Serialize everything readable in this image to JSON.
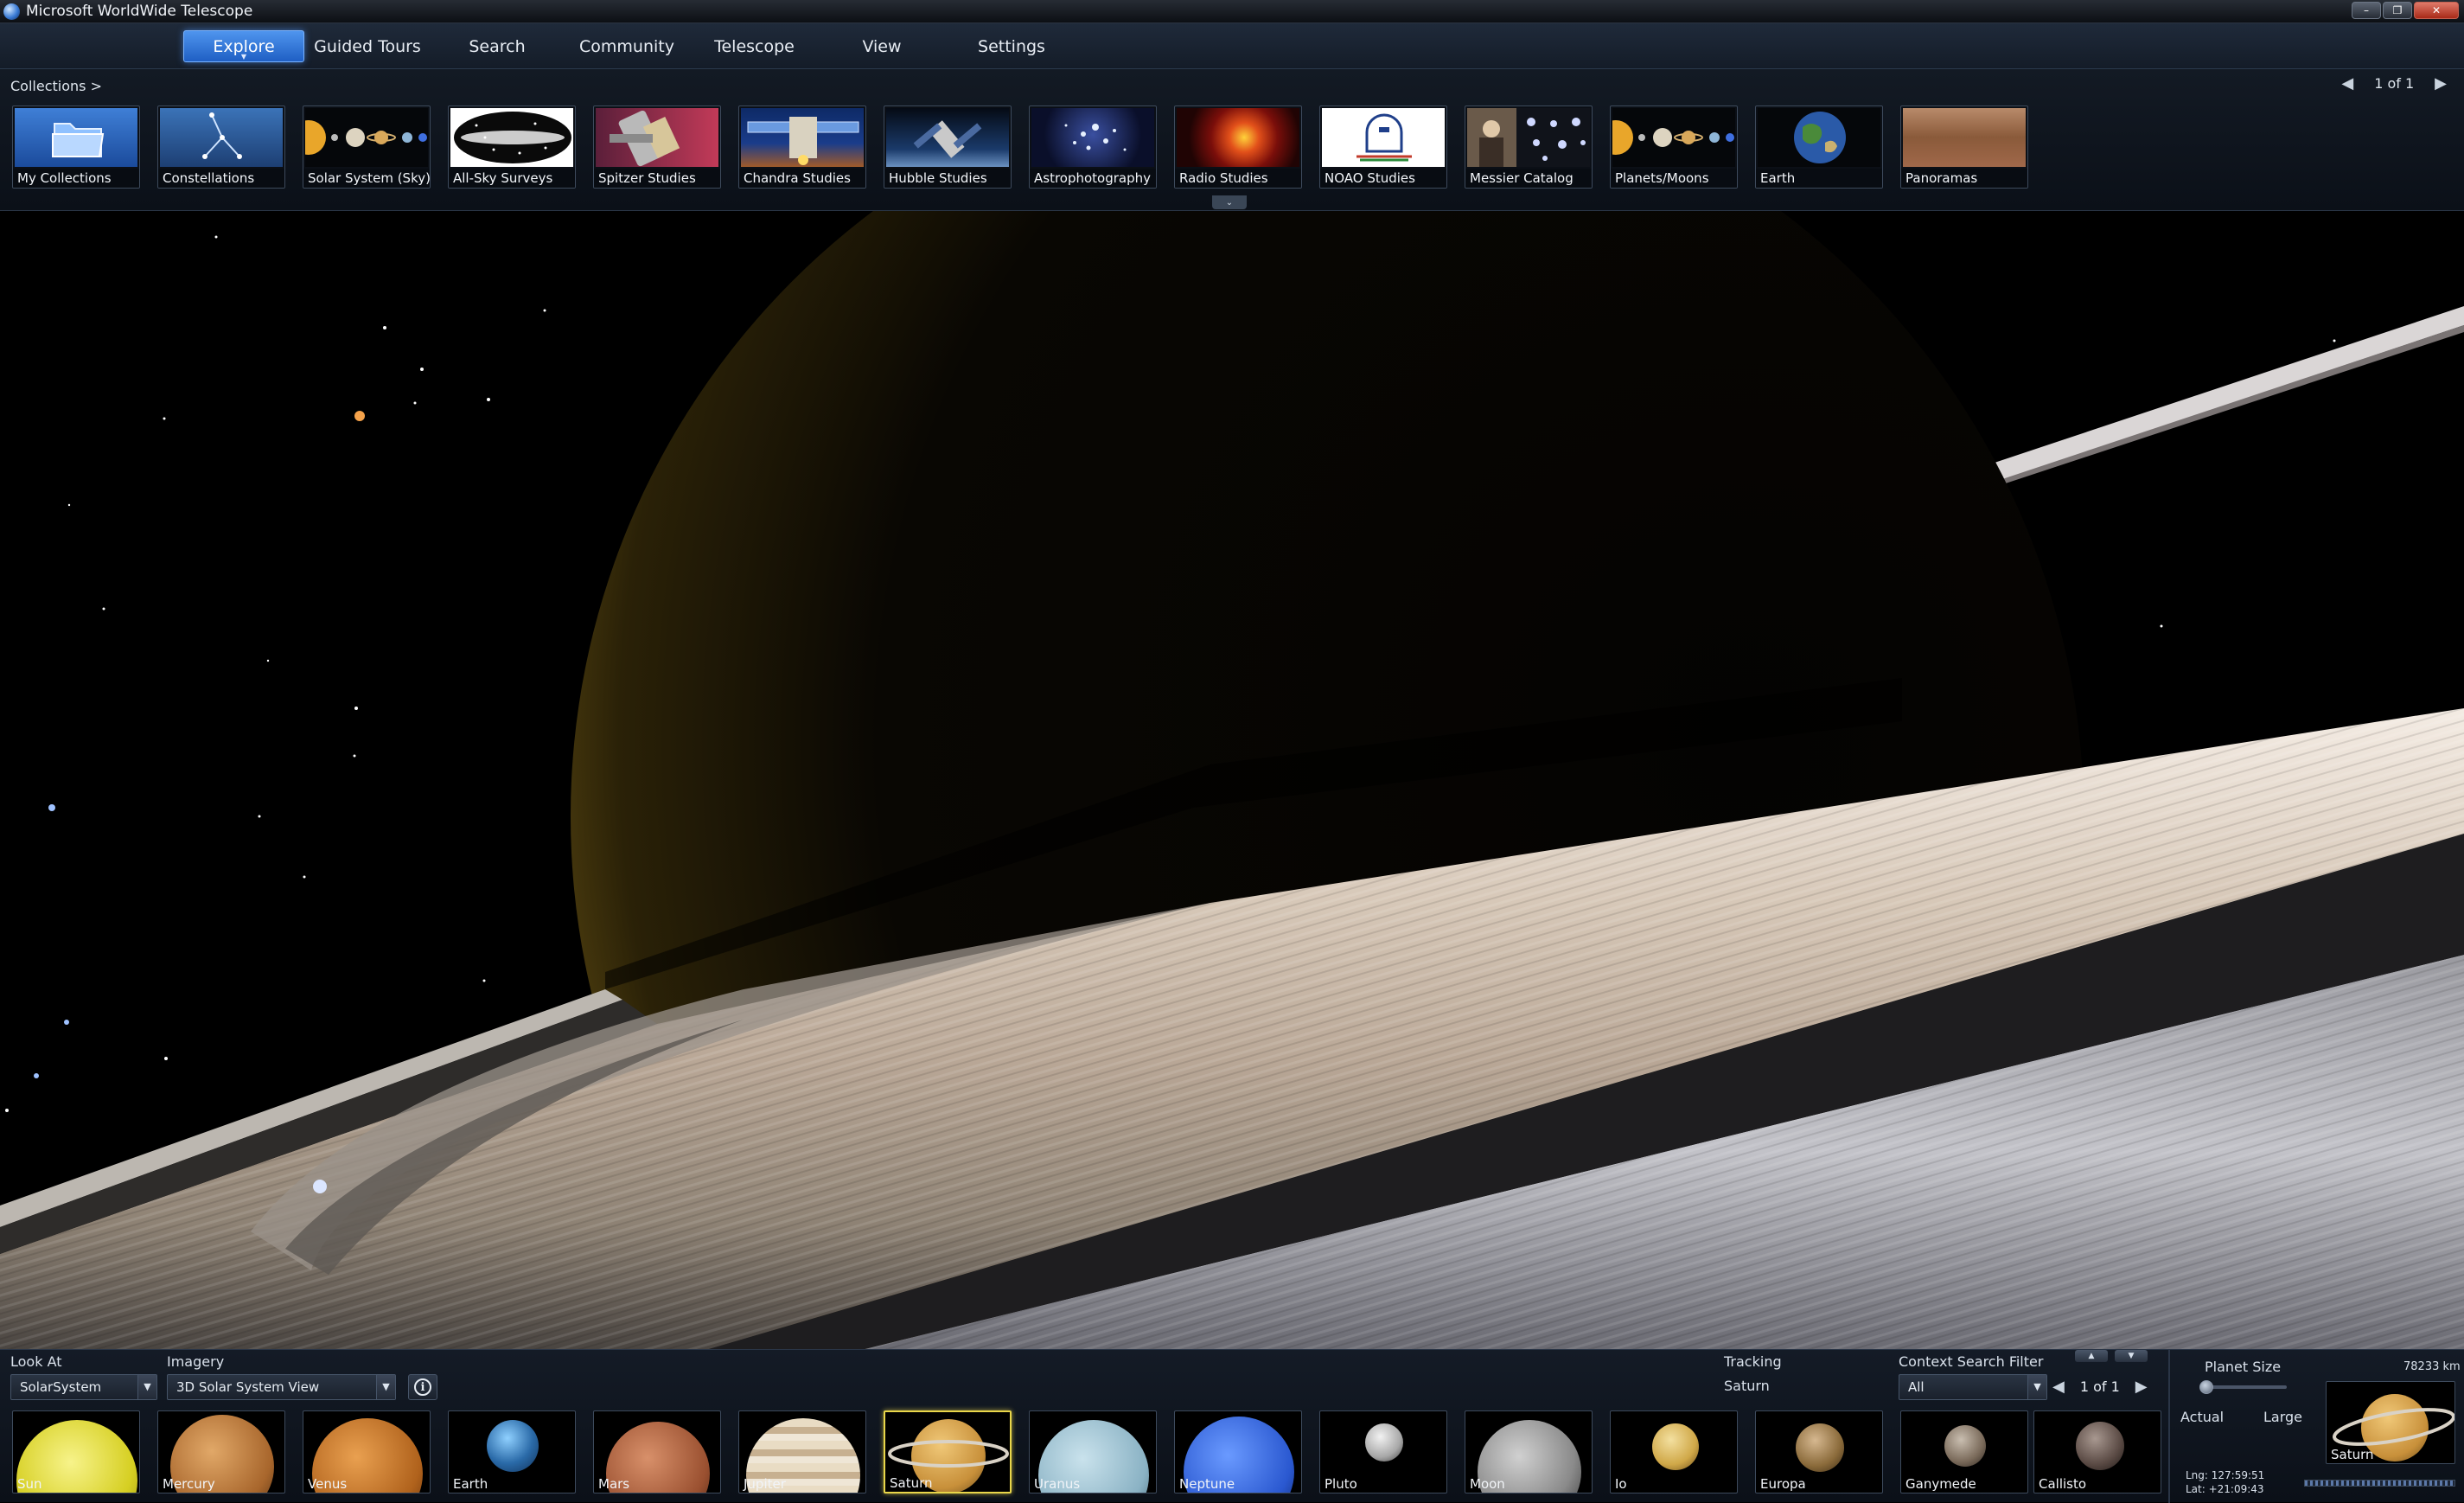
{
  "window": {
    "title": "Microsoft WorldWide Telescope",
    "controls": [
      "–",
      "❐",
      "✕"
    ]
  },
  "menu": {
    "items": [
      {
        "label": "Explore",
        "active": true
      },
      {
        "label": "Guided Tours",
        "active": false
      },
      {
        "label": "Search",
        "active": false
      },
      {
        "label": "Community",
        "active": false
      },
      {
        "label": "Telescope",
        "active": false
      },
      {
        "label": "View",
        "active": false
      },
      {
        "label": "Settings",
        "active": false
      }
    ]
  },
  "explore": {
    "breadcrumb": "Collections  >",
    "pager": {
      "prev": "◀",
      "text": "1 of 1",
      "next": "▶"
    },
    "collapse_glyph": "⌄",
    "collections": [
      {
        "label": "My Collections",
        "icon": "folder-icon"
      },
      {
        "label": "Constellations",
        "icon": "constellation-icon"
      },
      {
        "label": "Solar System (Sky)",
        "icon": "solar-system-icon"
      },
      {
        "label": "All-Sky Surveys",
        "icon": "all-sky-icon"
      },
      {
        "label": "Spitzer Studies",
        "icon": "spitzer-telescope-icon"
      },
      {
        "label": "Chandra Studies",
        "icon": "chandra-telescope-icon"
      },
      {
        "label": "Hubble Studies",
        "icon": "hubble-telescope-icon"
      },
      {
        "label": "Astrophotography",
        "icon": "star-cluster-icon"
      },
      {
        "label": "Radio Studies",
        "icon": "radio-nebula-icon"
      },
      {
        "label": "NOAO Studies",
        "icon": "noao-logo-icon"
      },
      {
        "label": "Messier Catalog",
        "icon": "messier-portrait-icon"
      },
      {
        "label": "Planets/Moons",
        "icon": "planets-moons-icon"
      },
      {
        "label": "Earth",
        "icon": "earth-globe-icon"
      },
      {
        "label": "Panoramas",
        "icon": "mars-panorama-icon"
      }
    ]
  },
  "bottom": {
    "look_at": {
      "label": "Look At",
      "value": "SolarSystem"
    },
    "imagery": {
      "label": "Imagery",
      "value": "3D Solar System View"
    },
    "info_glyph": "i",
    "tracking": {
      "label": "Tracking",
      "value": "Saturn"
    },
    "context_filter": {
      "label": "Context Search Filter",
      "value": "All"
    },
    "pager": {
      "prev": "◀",
      "text": "1 of 1",
      "next": "▶"
    },
    "updown": [
      "▲",
      "▼"
    ],
    "planet_size": {
      "label": "Planet Size",
      "min_label": "Actual",
      "max_label": "Large",
      "value": 0.0
    },
    "distance": "78233 km",
    "current": "Saturn",
    "coords": {
      "lng": "Lng:  127:59:51",
      "lat": "Lat:  +21:09:43"
    },
    "dropdown_glyph": "▼",
    "planets": [
      {
        "label": "Sun",
        "color": "#e9e23a",
        "selected": false
      },
      {
        "label": "Mercury",
        "color": "#b87a3e",
        "selected": false
      },
      {
        "label": "Venus",
        "color": "#c57a2c",
        "selected": false
      },
      {
        "label": "Earth",
        "color": "#3a6aa8",
        "selected": false
      },
      {
        "label": "Mars",
        "color": "#b0603a",
        "selected": false
      },
      {
        "label": "Jupiter",
        "color": "#d9c4a4",
        "selected": false
      },
      {
        "label": "Saturn",
        "color": "#d9a85a",
        "selected": true
      },
      {
        "label": "Uranus",
        "color": "#9ec0cf",
        "selected": false
      },
      {
        "label": "Neptune",
        "color": "#2f5fd6",
        "selected": false
      },
      {
        "label": "Pluto",
        "color": "#a9a9a9",
        "selected": false
      },
      {
        "label": "Moon",
        "color": "#8d8d8d",
        "selected": false
      },
      {
        "label": "Io",
        "color": "#d6b25a",
        "selected": false
      },
      {
        "label": "Europa",
        "color": "#9a7a4a",
        "selected": false
      },
      {
        "label": "Ganymede",
        "color": "#8a7a6a",
        "selected": false
      },
      {
        "label": "Callisto",
        "color": "#5a4e4a",
        "selected": false
      }
    ]
  }
}
